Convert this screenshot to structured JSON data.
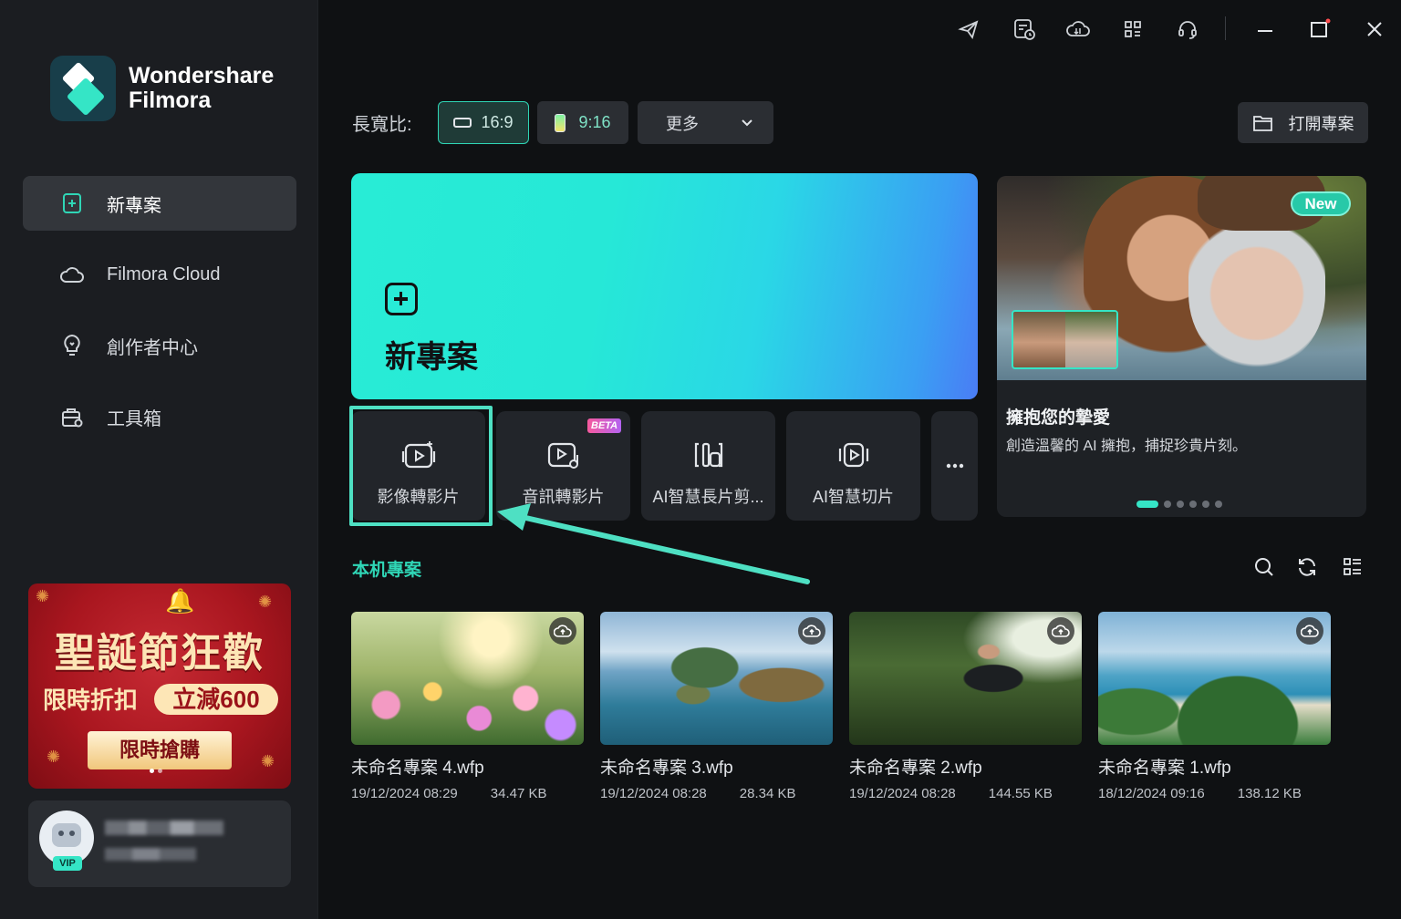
{
  "app": {
    "brand_line1": "Wondershare",
    "brand_line2": "Filmora"
  },
  "sidebar": {
    "items": [
      {
        "label": "新專案",
        "icon": "new-project-icon",
        "active": true
      },
      {
        "label": "Filmora Cloud",
        "icon": "cloud-icon",
        "active": false
      },
      {
        "label": "創作者中心",
        "icon": "lightbulb-icon",
        "active": false
      },
      {
        "label": "工具箱",
        "icon": "toolbox-icon",
        "active": false
      }
    ],
    "promo": {
      "title": "聖誕節狂歡",
      "discount_label": "限時折扣",
      "save_label": "立減600",
      "buy_label": "限時搶購"
    },
    "user": {
      "vip_label": "VIP"
    }
  },
  "titlebar": {
    "icons": [
      "send-feedback-icon",
      "task-schedule-icon",
      "cloud-sync-icon",
      "apps-grid-icon",
      "support-headset-icon",
      "minimize-icon",
      "maximize-icon",
      "close-icon"
    ]
  },
  "aspect": {
    "label": "長寬比:",
    "options": [
      {
        "label": "16:9",
        "active": true
      },
      {
        "label": "9:16",
        "active": false
      },
      {
        "label": "更多",
        "active": false
      }
    ],
    "open_project_label": "打開專案"
  },
  "hero": {
    "title": "新專案"
  },
  "tools": [
    {
      "label": "影像轉影片",
      "icon": "image-to-video-icon"
    },
    {
      "label": "音訊轉影片",
      "icon": "audio-to-video-icon",
      "badge": "BETA"
    },
    {
      "label": "AI智慧長片剪...",
      "icon": "ai-long-video-icon"
    },
    {
      "label": "AI智慧切片",
      "icon": "ai-clip-icon"
    },
    {
      "label": "...",
      "icon": "more-icon"
    }
  ],
  "feature": {
    "badge": "New",
    "title": "擁抱您的摯愛",
    "description": "創造溫馨的 AI 擁抱，捕捉珍貴片刻。",
    "slides": 6,
    "active_slide": 1
  },
  "projects": {
    "section_title": "本机專案",
    "items": [
      {
        "name": "未命名專案 4.wfp",
        "date": "19/12/2024 08:29",
        "size": "34.47 KB"
      },
      {
        "name": "未命名專案 3.wfp",
        "date": "19/12/2024 08:28",
        "size": "28.34 KB"
      },
      {
        "name": "未命名專案 2.wfp",
        "date": "19/12/2024 08:28",
        "size": "144.55 KB"
      },
      {
        "name": "未命名專案 1.wfp",
        "date": "18/12/2024 09:16",
        "size": "138.12 KB"
      }
    ]
  },
  "colors": {
    "accent": "#2fd6b6",
    "sidebar_bg": "#1b1d21",
    "main_bg": "#0f1113",
    "highlight": "#4ee0c3"
  }
}
